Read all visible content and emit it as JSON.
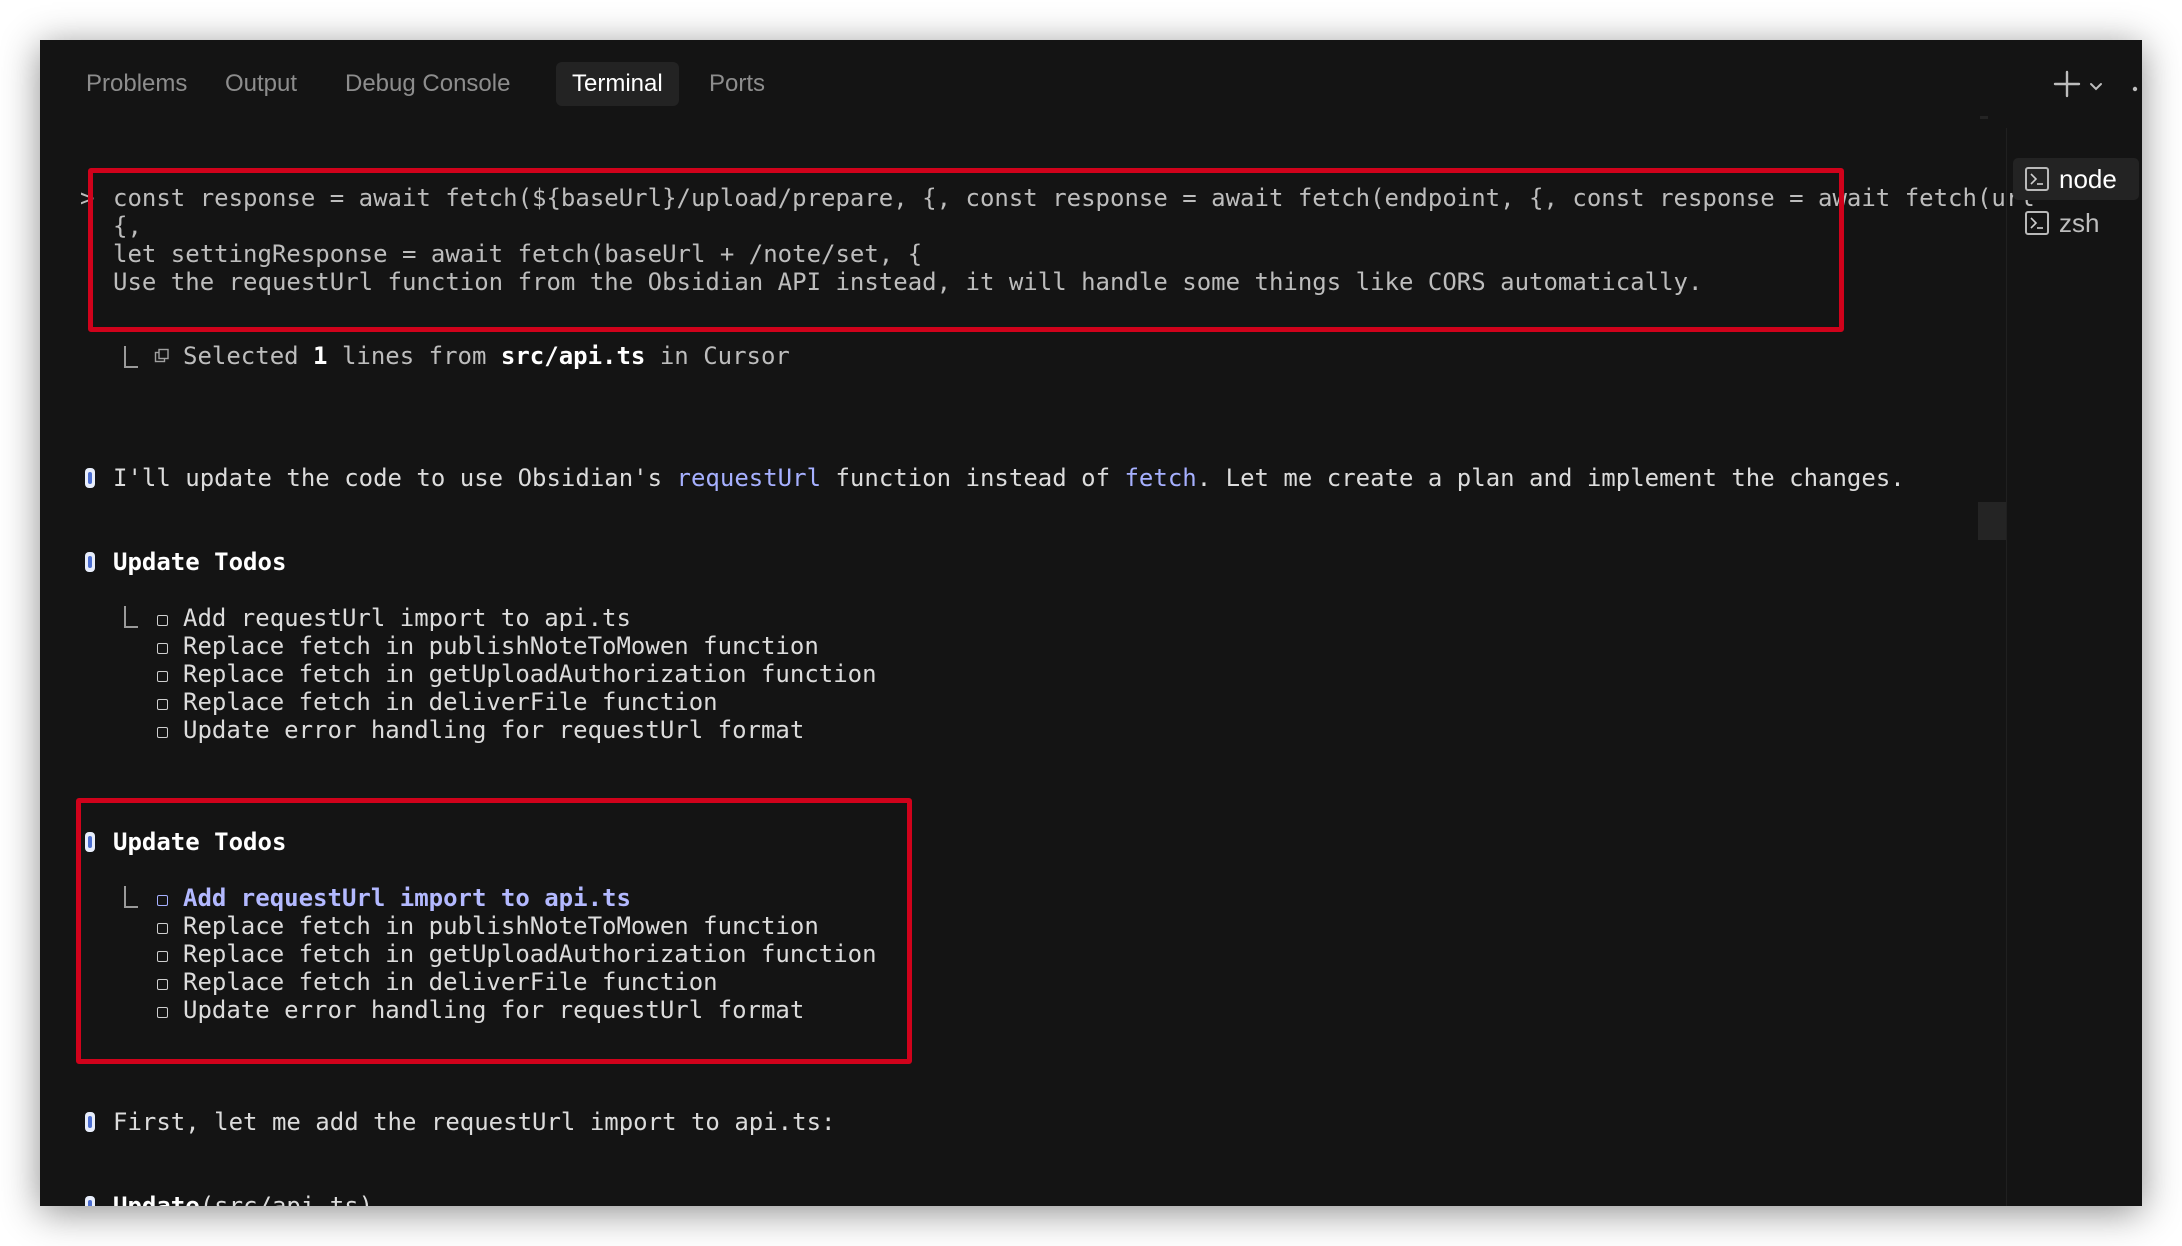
{
  "tabs": [
    {
      "label": "Problems",
      "active": false
    },
    {
      "label": "Output",
      "active": false
    },
    {
      "label": "Debug Console",
      "active": false
    },
    {
      "label": "Terminal",
      "active": true
    },
    {
      "label": "Ports",
      "active": false
    }
  ],
  "toolbar": {
    "new_terminal_icon": "plus-icon",
    "dropdown_icon": "chevron-down-icon",
    "more_icon": "ellipsis-icon"
  },
  "terminals": [
    {
      "label": "node",
      "active": true
    },
    {
      "label": "zsh",
      "active": false
    }
  ],
  "prompt": {
    "marker": ">",
    "line1": "const response = await fetch(${baseUrl}/upload/prepare, {, const response = await fetch(endpoint, {, const response = await fetch(url",
    "line2": "{,",
    "line3": "let settingResponse = await fetch(baseUrl + /note/set, {",
    "line4": "Use the requestUrl function from the Obsidian API instead, it will handle some things like CORS automatically."
  },
  "selection": {
    "prefix": "Selected ",
    "count": "1",
    "middle": " lines from ",
    "file": "src/api.ts",
    "suffix": " in Cursor"
  },
  "assistant_message": {
    "part1": "I'll update the code to use Obsidian's ",
    "code1": "requestUrl",
    "part2": " function instead of ",
    "code2": "fetch",
    "part3": ". Let me create a plan and implement the changes."
  },
  "todo_blocks": [
    {
      "title": "Update Todos",
      "items": [
        "Add requestUrl import to api.ts",
        "Replace fetch in publishNoteToMowen function",
        "Replace fetch in getUploadAuthorization function",
        "Replace fetch in deliverFile function",
        "Update error handling for requestUrl format"
      ]
    },
    {
      "title": "Update Todos",
      "active_item": 0,
      "items": [
        "Add requestUrl import to api.ts",
        "Replace fetch in publishNoteToMowen function",
        "Replace fetch in getUploadAuthorization function",
        "Replace fetch in deliverFile function",
        "Update error handling for requestUrl format"
      ]
    }
  ],
  "next_message": "First, let me add the requestUrl import to api.ts:",
  "update_call": {
    "name": "Update",
    "arg": "(src/api.ts)"
  },
  "colors": {
    "highlight": "#d0021b",
    "background": "#141414",
    "accent": "#a6b0ff"
  }
}
